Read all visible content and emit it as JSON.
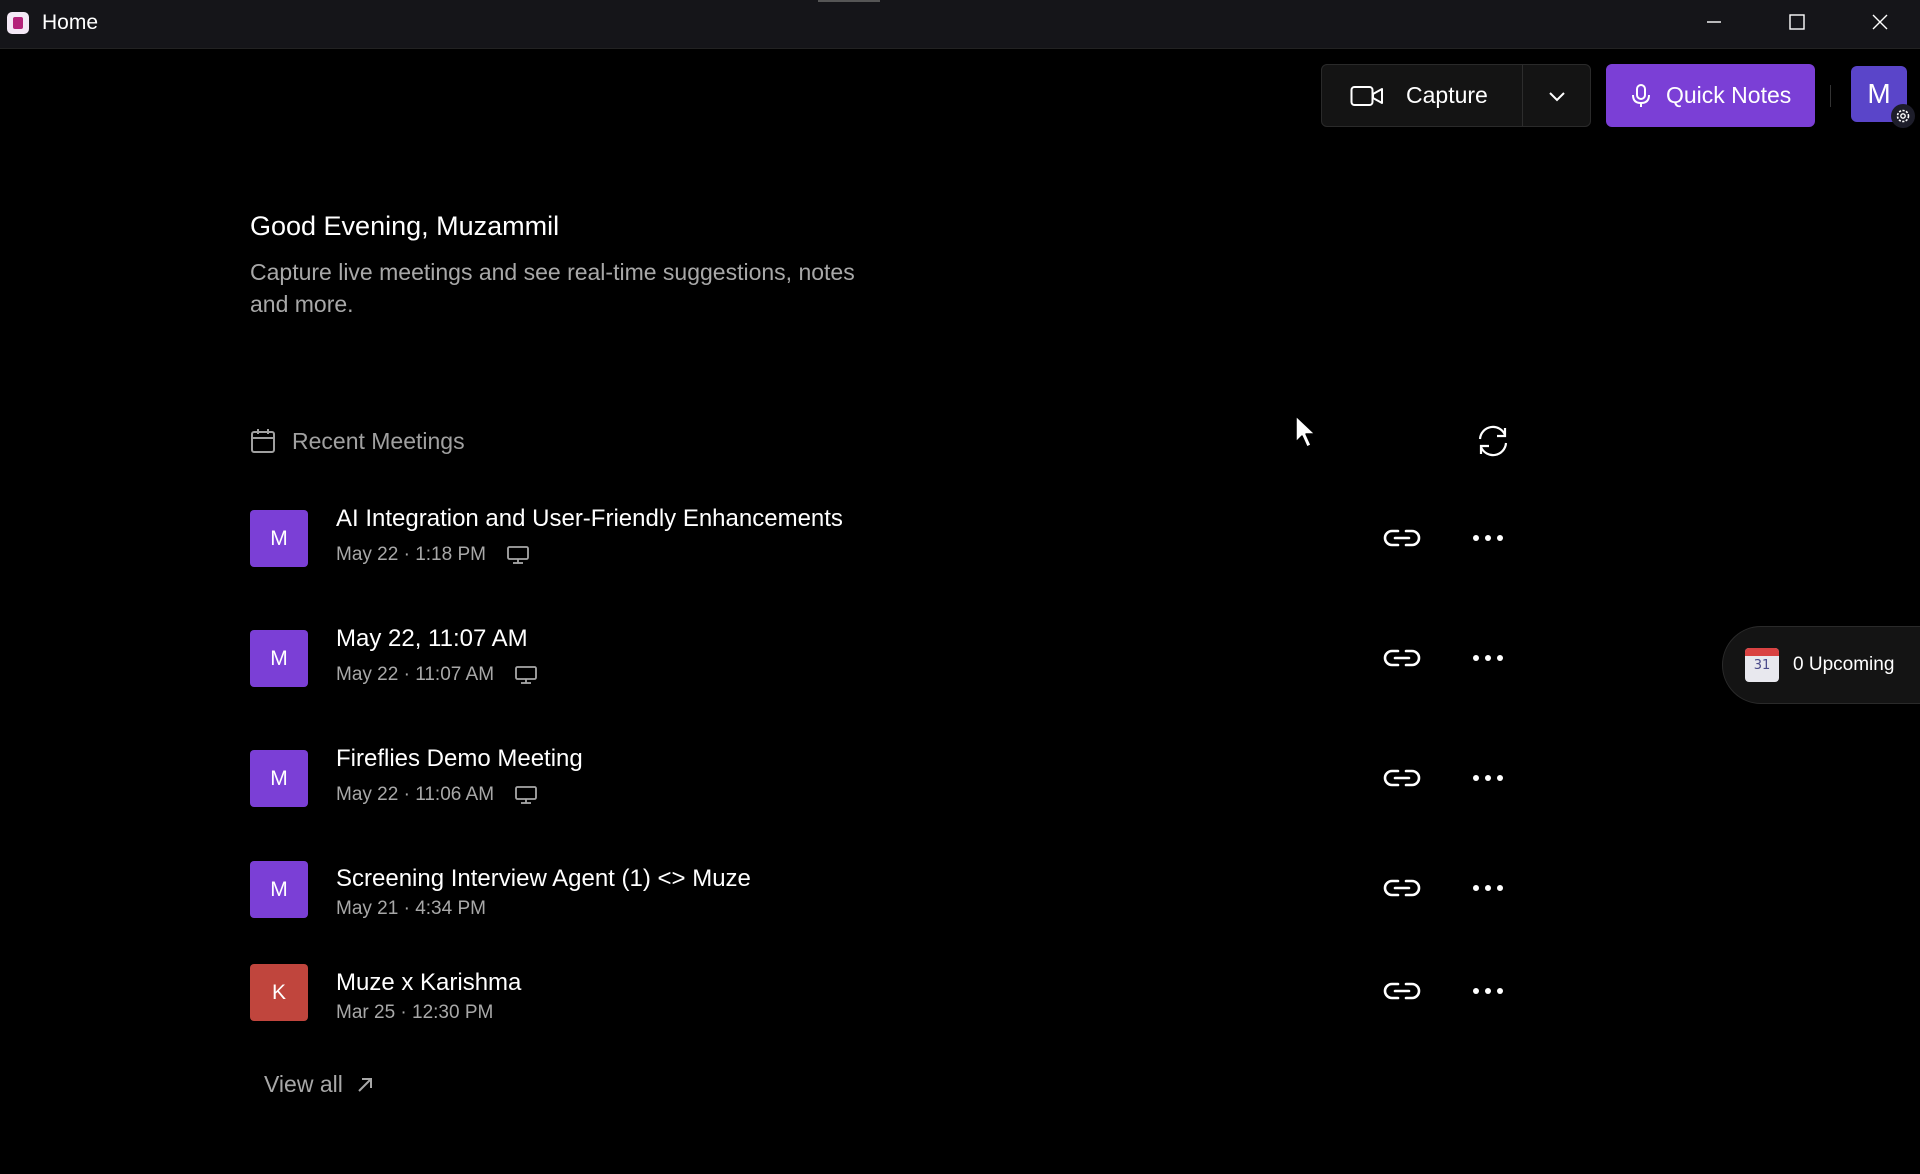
{
  "window": {
    "title": "Home"
  },
  "toolbar": {
    "capture_label": "Capture",
    "quick_notes_label": "Quick Notes",
    "avatar_initial": "M"
  },
  "greeting": {
    "title": "Good Evening, Muzammil",
    "subtitle": "Capture live meetings and see real-time suggestions, notes and more."
  },
  "recent": {
    "header": "Recent Meetings",
    "meetings": [
      {
        "initial": "M",
        "color": "#7b3fd6",
        "title": "AI Integration and User-Friendly Enhancements",
        "date": "May 22 · 1:18 PM",
        "device_icon": true
      },
      {
        "initial": "M",
        "color": "#7b3fd6",
        "title": "May 22, 11:07 AM",
        "date": "May 22 · 11:07 AM",
        "device_icon": true
      },
      {
        "initial": "M",
        "color": "#7b3fd6",
        "title": "Fireflies Demo Meeting",
        "date": "May 22 · 11:06 AM",
        "device_icon": true
      },
      {
        "initial": "M",
        "color": "#7b3fd6",
        "title": "Screening Interview Agent (1) <> Muze",
        "date": "May 21 · 4:34 PM",
        "device_icon": false
      },
      {
        "initial": "K",
        "color": "#c0453d",
        "title": "Muze x Karishma",
        "date": "Mar 25 · 12:30 PM",
        "device_icon": false
      }
    ],
    "view_all_label": "View all"
  },
  "upcoming": {
    "calendar_day": "31",
    "label": "0 Upcoming"
  },
  "colors": {
    "accent": "#7b3fd6",
    "background": "#000000"
  }
}
